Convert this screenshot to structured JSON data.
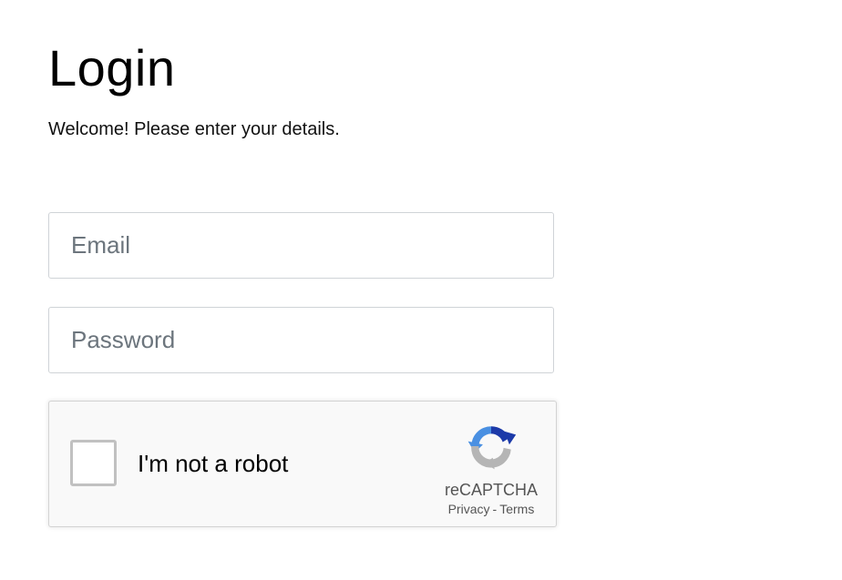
{
  "header": {
    "title": "Login",
    "subtitle": "Welcome! Please enter your details."
  },
  "form": {
    "email": {
      "placeholder": "Email",
      "value": ""
    },
    "password": {
      "placeholder": "Password",
      "value": ""
    }
  },
  "recaptcha": {
    "checkbox_label": "I'm not a robot",
    "checked": false,
    "brand": "reCAPTCHA",
    "privacy_link": "Privacy",
    "separator": "-",
    "terms_link": "Terms",
    "logo_icon": "recaptcha-logo-icon",
    "colors": {
      "blue_dark": "#1c3aa9",
      "blue": "#4a90e2",
      "gray": "#b5b5b5"
    }
  }
}
